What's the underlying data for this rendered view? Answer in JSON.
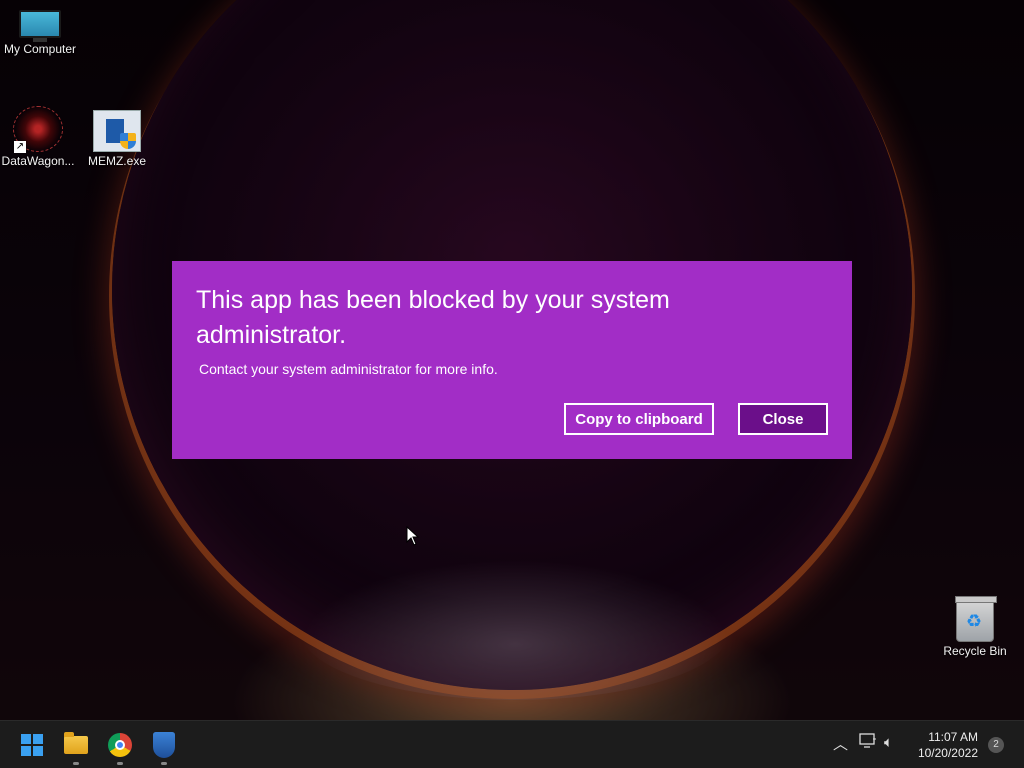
{
  "desktop": {
    "icons": [
      {
        "label": "My Computer"
      },
      {
        "label": "DataWagon..."
      },
      {
        "label": "MEMZ.exe"
      },
      {
        "label": "Recycle Bin"
      }
    ]
  },
  "dialog": {
    "title": "This app has been blocked by your system administrator.",
    "message": "Contact your system administrator for more info.",
    "copy_label": "Copy to clipboard",
    "close_label": "Close",
    "background_color": "#a22dc6"
  },
  "taskbar": {
    "pinned": [
      "start-icon",
      "file-explorer-icon",
      "chrome-icon",
      "windows-security-icon"
    ],
    "tray": {
      "time": "11:07 AM",
      "date": "10/20/2022",
      "notification_count": "2"
    }
  }
}
